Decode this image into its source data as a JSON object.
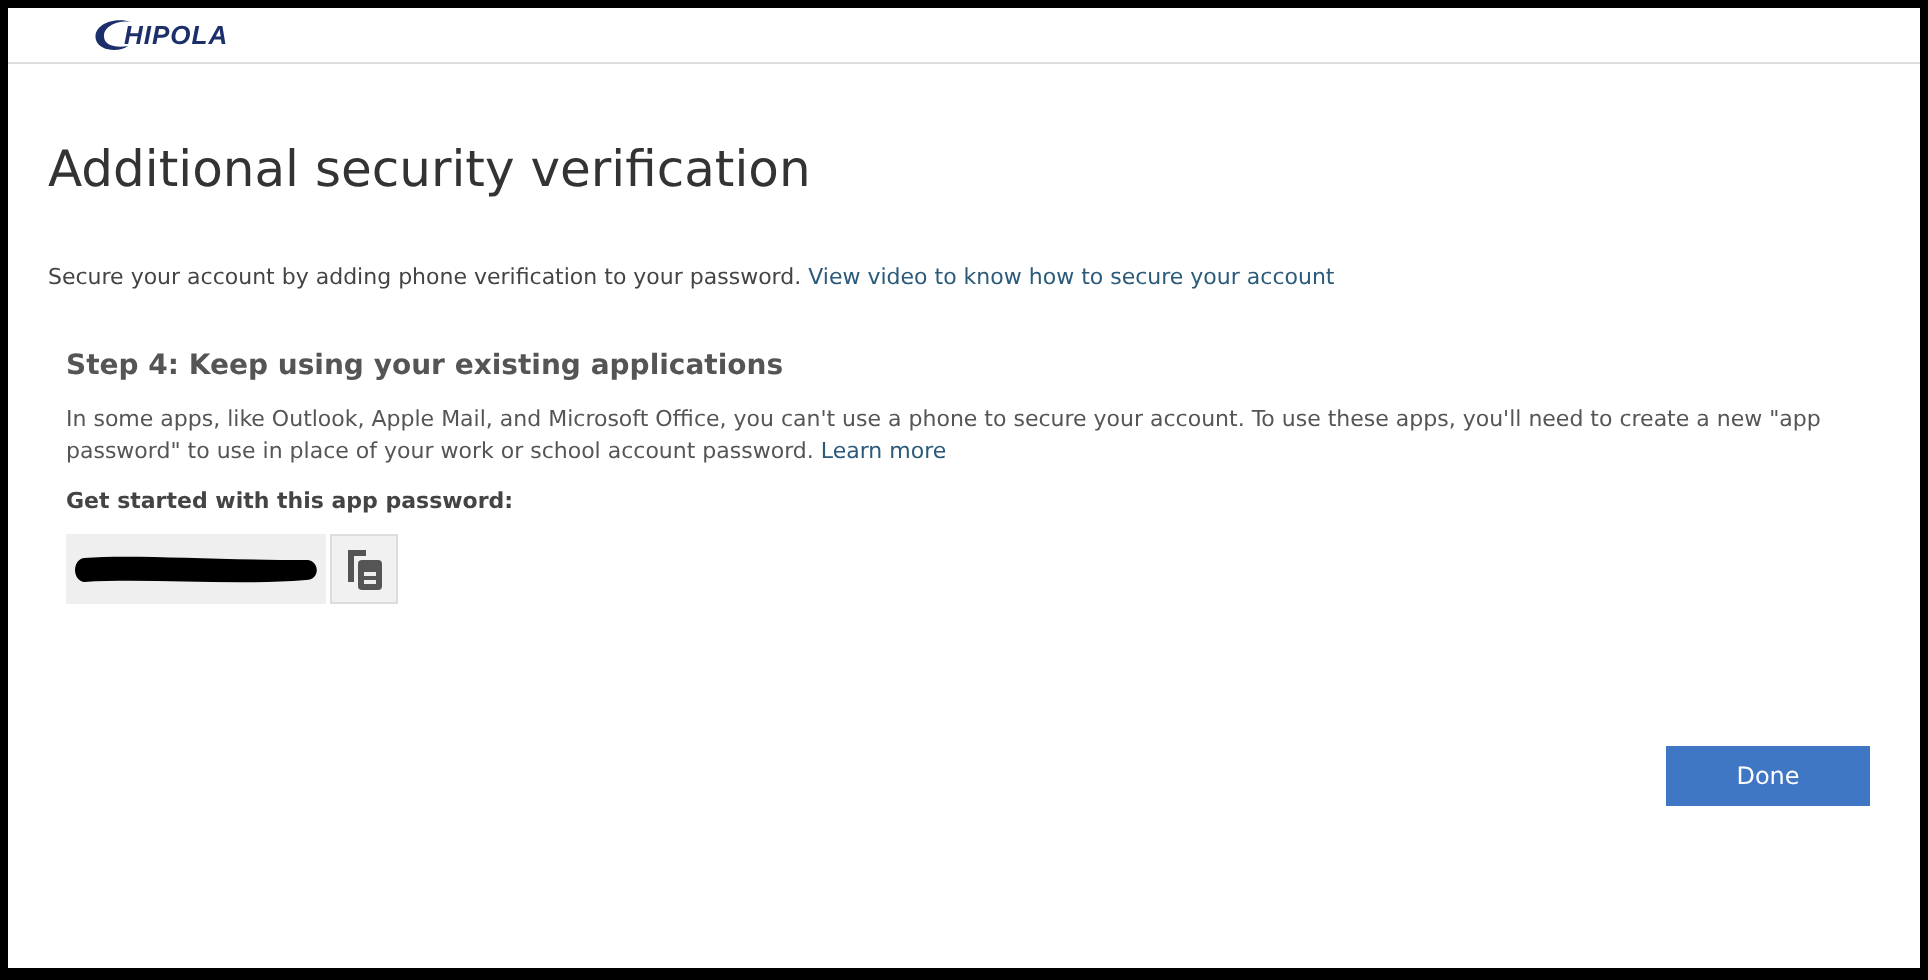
{
  "header": {
    "logo_text": "HIPOLA"
  },
  "title": "Additional security verification",
  "intro": {
    "text": "Secure your account by adding phone verification to your password.",
    "link": "View video to know how to secure your account"
  },
  "step": {
    "heading": "Step 4: Keep using your existing applications",
    "body": "In some apps, like Outlook, Apple Mail, and Microsoft Office, you can't use a phone to secure your account. To use these apps, you'll need to create a new \"app password\" to use in place of your work or school account password.",
    "link": "Learn more",
    "password_label": "Get started with this app password:"
  },
  "buttons": [
    {
      "label": "Done",
      "kind": "primary"
    }
  ]
}
